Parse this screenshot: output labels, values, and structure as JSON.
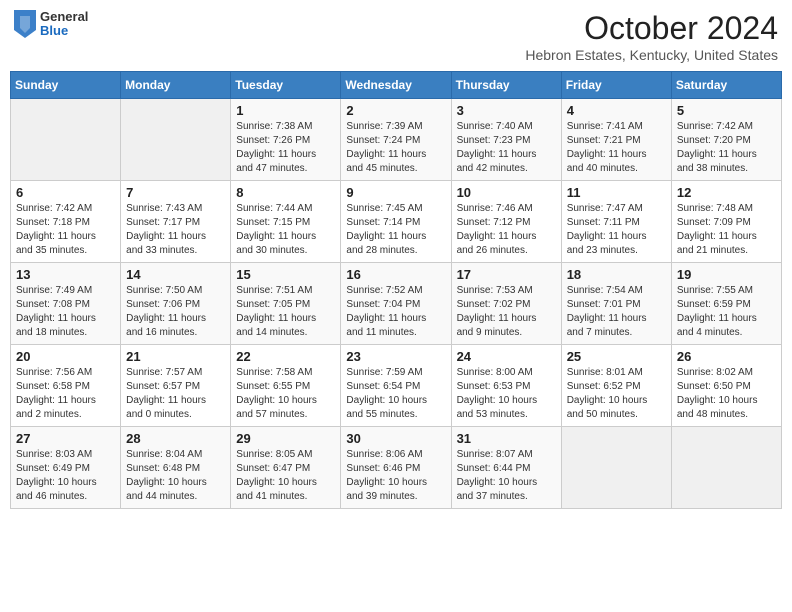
{
  "header": {
    "logo": {
      "general": "General",
      "blue": "Blue"
    },
    "title": "October 2024",
    "location": "Hebron Estates, Kentucky, United States"
  },
  "days_of_week": [
    "Sunday",
    "Monday",
    "Tuesday",
    "Wednesday",
    "Thursday",
    "Friday",
    "Saturday"
  ],
  "weeks": [
    [
      {
        "day": "",
        "info": ""
      },
      {
        "day": "",
        "info": ""
      },
      {
        "day": "1",
        "sunrise": "Sunrise: 7:38 AM",
        "sunset": "Sunset: 7:26 PM",
        "daylight": "Daylight: 11 hours and 47 minutes."
      },
      {
        "day": "2",
        "sunrise": "Sunrise: 7:39 AM",
        "sunset": "Sunset: 7:24 PM",
        "daylight": "Daylight: 11 hours and 45 minutes."
      },
      {
        "day": "3",
        "sunrise": "Sunrise: 7:40 AM",
        "sunset": "Sunset: 7:23 PM",
        "daylight": "Daylight: 11 hours and 42 minutes."
      },
      {
        "day": "4",
        "sunrise": "Sunrise: 7:41 AM",
        "sunset": "Sunset: 7:21 PM",
        "daylight": "Daylight: 11 hours and 40 minutes."
      },
      {
        "day": "5",
        "sunrise": "Sunrise: 7:42 AM",
        "sunset": "Sunset: 7:20 PM",
        "daylight": "Daylight: 11 hours and 38 minutes."
      }
    ],
    [
      {
        "day": "6",
        "sunrise": "Sunrise: 7:42 AM",
        "sunset": "Sunset: 7:18 PM",
        "daylight": "Daylight: 11 hours and 35 minutes."
      },
      {
        "day": "7",
        "sunrise": "Sunrise: 7:43 AM",
        "sunset": "Sunset: 7:17 PM",
        "daylight": "Daylight: 11 hours and 33 minutes."
      },
      {
        "day": "8",
        "sunrise": "Sunrise: 7:44 AM",
        "sunset": "Sunset: 7:15 PM",
        "daylight": "Daylight: 11 hours and 30 minutes."
      },
      {
        "day": "9",
        "sunrise": "Sunrise: 7:45 AM",
        "sunset": "Sunset: 7:14 PM",
        "daylight": "Daylight: 11 hours and 28 minutes."
      },
      {
        "day": "10",
        "sunrise": "Sunrise: 7:46 AM",
        "sunset": "Sunset: 7:12 PM",
        "daylight": "Daylight: 11 hours and 26 minutes."
      },
      {
        "day": "11",
        "sunrise": "Sunrise: 7:47 AM",
        "sunset": "Sunset: 7:11 PM",
        "daylight": "Daylight: 11 hours and 23 minutes."
      },
      {
        "day": "12",
        "sunrise": "Sunrise: 7:48 AM",
        "sunset": "Sunset: 7:09 PM",
        "daylight": "Daylight: 11 hours and 21 minutes."
      }
    ],
    [
      {
        "day": "13",
        "sunrise": "Sunrise: 7:49 AM",
        "sunset": "Sunset: 7:08 PM",
        "daylight": "Daylight: 11 hours and 18 minutes."
      },
      {
        "day": "14",
        "sunrise": "Sunrise: 7:50 AM",
        "sunset": "Sunset: 7:06 PM",
        "daylight": "Daylight: 11 hours and 16 minutes."
      },
      {
        "day": "15",
        "sunrise": "Sunrise: 7:51 AM",
        "sunset": "Sunset: 7:05 PM",
        "daylight": "Daylight: 11 hours and 14 minutes."
      },
      {
        "day": "16",
        "sunrise": "Sunrise: 7:52 AM",
        "sunset": "Sunset: 7:04 PM",
        "daylight": "Daylight: 11 hours and 11 minutes."
      },
      {
        "day": "17",
        "sunrise": "Sunrise: 7:53 AM",
        "sunset": "Sunset: 7:02 PM",
        "daylight": "Daylight: 11 hours and 9 minutes."
      },
      {
        "day": "18",
        "sunrise": "Sunrise: 7:54 AM",
        "sunset": "Sunset: 7:01 PM",
        "daylight": "Daylight: 11 hours and 7 minutes."
      },
      {
        "day": "19",
        "sunrise": "Sunrise: 7:55 AM",
        "sunset": "Sunset: 6:59 PM",
        "daylight": "Daylight: 11 hours and 4 minutes."
      }
    ],
    [
      {
        "day": "20",
        "sunrise": "Sunrise: 7:56 AM",
        "sunset": "Sunset: 6:58 PM",
        "daylight": "Daylight: 11 hours and 2 minutes."
      },
      {
        "day": "21",
        "sunrise": "Sunrise: 7:57 AM",
        "sunset": "Sunset: 6:57 PM",
        "daylight": "Daylight: 11 hours and 0 minutes."
      },
      {
        "day": "22",
        "sunrise": "Sunrise: 7:58 AM",
        "sunset": "Sunset: 6:55 PM",
        "daylight": "Daylight: 10 hours and 57 minutes."
      },
      {
        "day": "23",
        "sunrise": "Sunrise: 7:59 AM",
        "sunset": "Sunset: 6:54 PM",
        "daylight": "Daylight: 10 hours and 55 minutes."
      },
      {
        "day": "24",
        "sunrise": "Sunrise: 8:00 AM",
        "sunset": "Sunset: 6:53 PM",
        "daylight": "Daylight: 10 hours and 53 minutes."
      },
      {
        "day": "25",
        "sunrise": "Sunrise: 8:01 AM",
        "sunset": "Sunset: 6:52 PM",
        "daylight": "Daylight: 10 hours and 50 minutes."
      },
      {
        "day": "26",
        "sunrise": "Sunrise: 8:02 AM",
        "sunset": "Sunset: 6:50 PM",
        "daylight": "Daylight: 10 hours and 48 minutes."
      }
    ],
    [
      {
        "day": "27",
        "sunrise": "Sunrise: 8:03 AM",
        "sunset": "Sunset: 6:49 PM",
        "daylight": "Daylight: 10 hours and 46 minutes."
      },
      {
        "day": "28",
        "sunrise": "Sunrise: 8:04 AM",
        "sunset": "Sunset: 6:48 PM",
        "daylight": "Daylight: 10 hours and 44 minutes."
      },
      {
        "day": "29",
        "sunrise": "Sunrise: 8:05 AM",
        "sunset": "Sunset: 6:47 PM",
        "daylight": "Daylight: 10 hours and 41 minutes."
      },
      {
        "day": "30",
        "sunrise": "Sunrise: 8:06 AM",
        "sunset": "Sunset: 6:46 PM",
        "daylight": "Daylight: 10 hours and 39 minutes."
      },
      {
        "day": "31",
        "sunrise": "Sunrise: 8:07 AM",
        "sunset": "Sunset: 6:44 PM",
        "daylight": "Daylight: 10 hours and 37 minutes."
      },
      {
        "day": "",
        "info": ""
      },
      {
        "day": "",
        "info": ""
      }
    ]
  ]
}
